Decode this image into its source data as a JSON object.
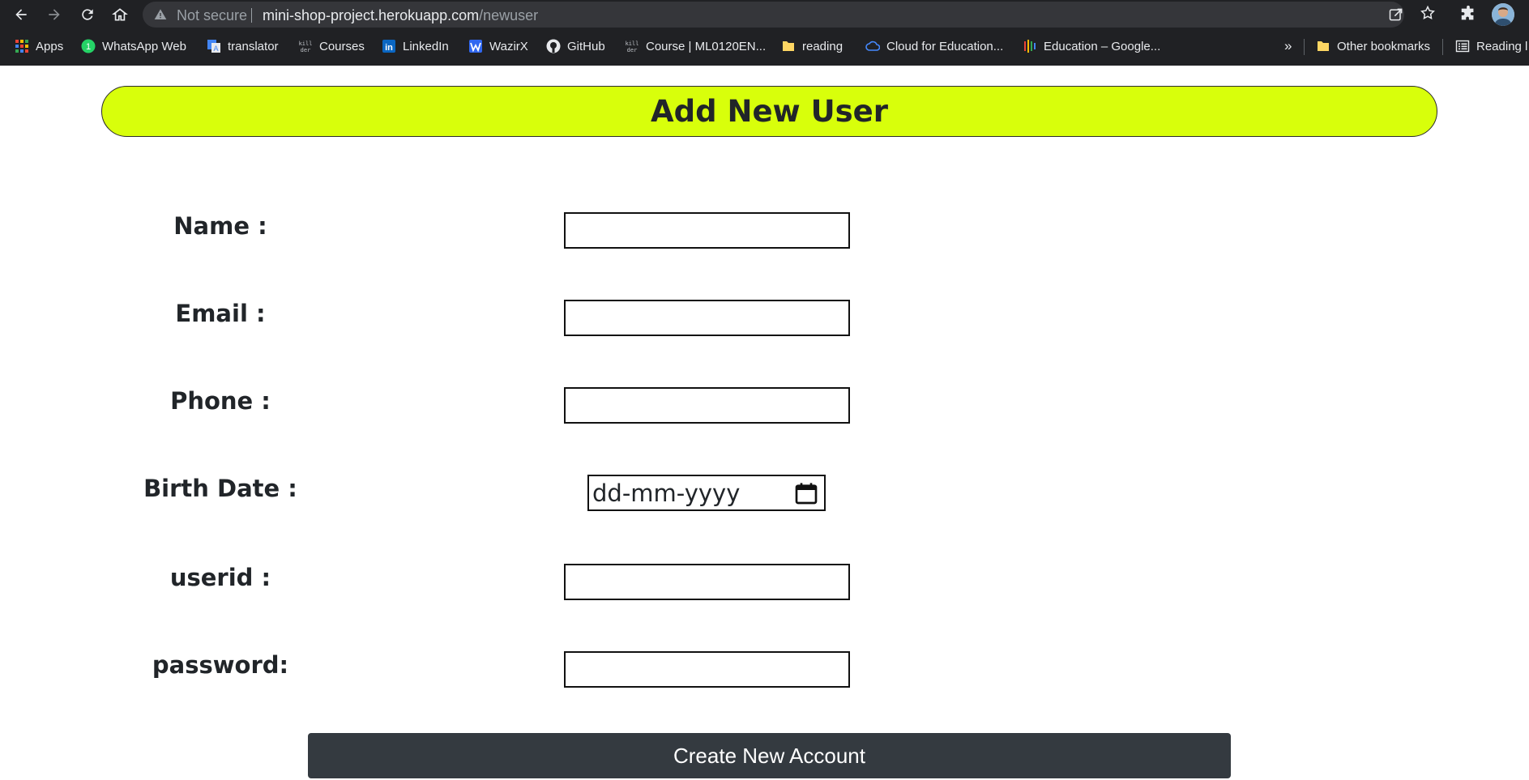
{
  "browser": {
    "security_label": "Not secure",
    "url_host": "mini-shop-project.herokuapp.com",
    "url_path": "/newuser",
    "bookmarks": [
      {
        "label": "Apps",
        "icon": "apps-grid-icon"
      },
      {
        "label": "WhatsApp Web",
        "icon": "whatsapp-icon"
      },
      {
        "label": "translator",
        "icon": "google-translate-icon"
      },
      {
        "label": "Courses",
        "icon": "killer-coder-icon"
      },
      {
        "label": "LinkedIn",
        "icon": "linkedin-icon"
      },
      {
        "label": "WazirX",
        "icon": "wazirx-icon"
      },
      {
        "label": "GitHub",
        "icon": "github-icon"
      },
      {
        "label": "Course | ML0120EN...",
        "icon": "killer-coder-icon"
      },
      {
        "label": "reading",
        "icon": "folder-icon"
      },
      {
        "label": "Cloud for Education...",
        "icon": "ibm-cloud-icon"
      },
      {
        "label": "Education – Google...",
        "icon": "google-education-icon"
      }
    ],
    "overflow_label": "»",
    "other_bookmarks_label": "Other bookmarks",
    "reading_list_label": "Reading l"
  },
  "page": {
    "title": "Add New User",
    "fields": [
      {
        "label": "Name :",
        "value": ""
      },
      {
        "label": "Email :",
        "value": ""
      },
      {
        "label": "Phone :",
        "value": ""
      },
      {
        "label": "Birth Date :",
        "placeholder": "dd-mm-yyyy"
      },
      {
        "label": "userid :",
        "value": ""
      },
      {
        "label": "password:",
        "value": ""
      }
    ],
    "submit_label": "Create New Account"
  },
  "colors": {
    "banner": "#d8ff0b",
    "button": "#343a40",
    "chrome": "#202124"
  }
}
